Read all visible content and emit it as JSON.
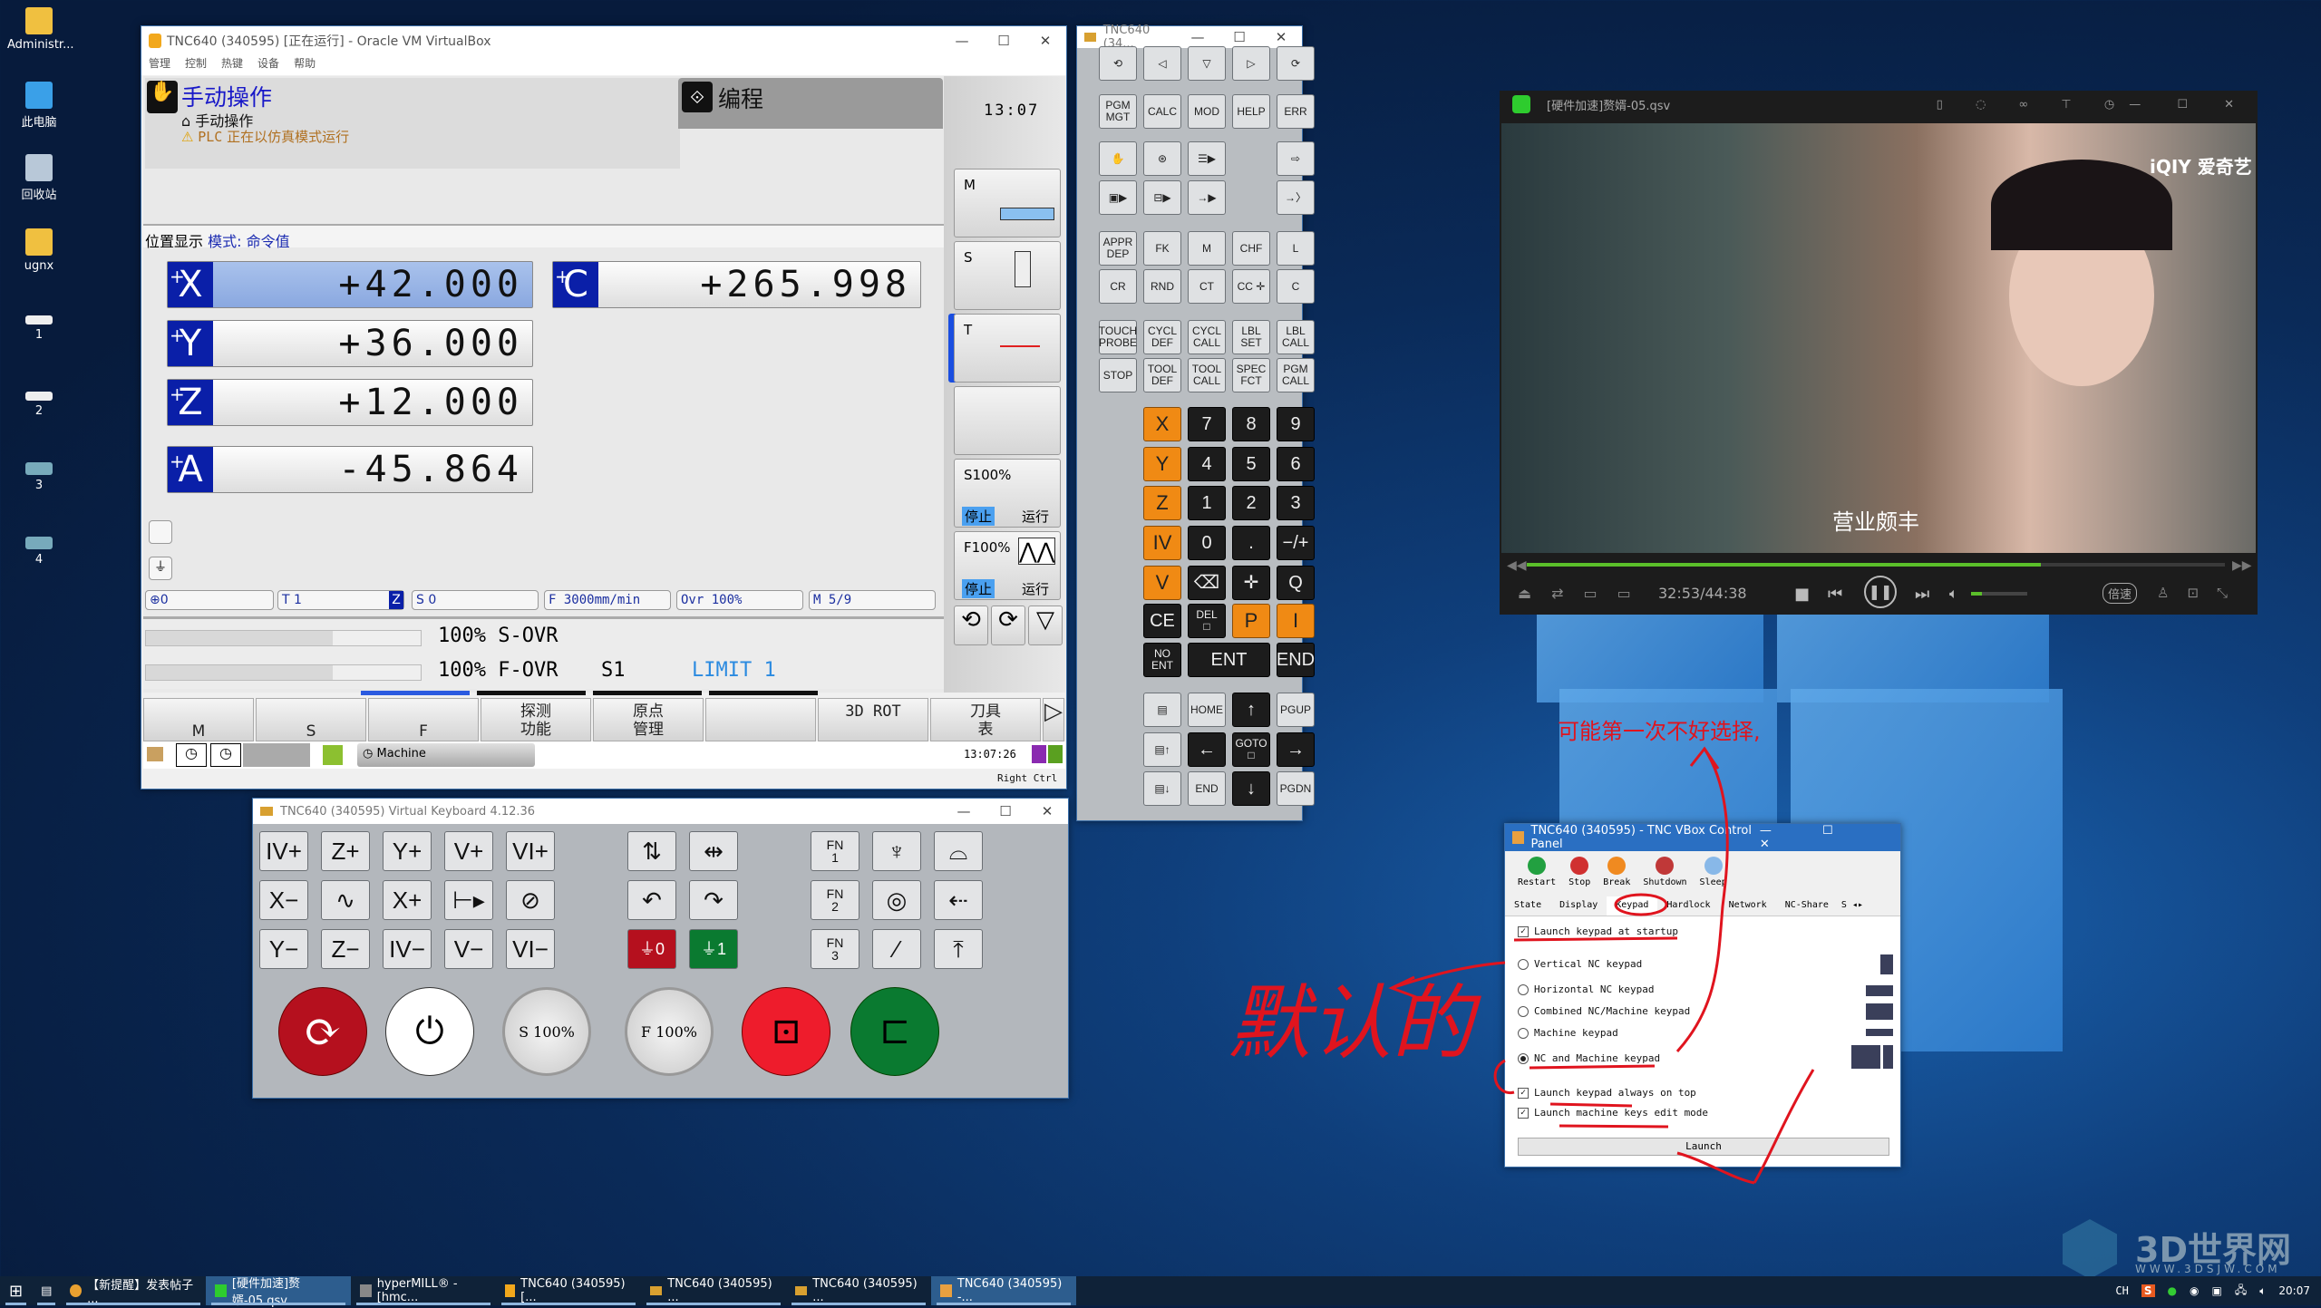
{
  "desktop": {
    "icons": [
      "Administr...",
      "此电脑",
      "回收站",
      "ugnx",
      "1",
      "2",
      "3",
      "4"
    ],
    "watermark": {
      "title": "3D世界网",
      "url": "WWW.3DSJW.COM"
    }
  },
  "tnc": {
    "window_title": "TNC640 (340595) [正在运行] - Oracle VM VirtualBox",
    "menu": [
      "管理",
      "控制",
      "热键",
      "设备",
      "帮助"
    ],
    "mode_title": "手动操作",
    "mode_sub": "手动操作",
    "plc_label": "PLC",
    "plc_msg": "正在以仿真模式运行",
    "prog_tab": "编程",
    "clock": "13:07",
    "pos_label": "位置显示",
    "pos_mode": "模式: 命令值",
    "axes": [
      {
        "name": "X",
        "value": "+42.000"
      },
      {
        "name": "Y",
        "value": "+36.000"
      },
      {
        "name": "Z",
        "value": "+12.000"
      },
      {
        "name": "A",
        "value": "-45.864"
      },
      {
        "name": "C",
        "value": "+265.998"
      }
    ],
    "status": {
      "preset": "0",
      "tool": "T 1",
      "tool_axis": "Z",
      "spindle": "S 0",
      "feed": "F 3000mm/min",
      "ovr": "Ovr 100%",
      "m": "M 5/9"
    },
    "s_ovr": "100% S-OVR",
    "f_ovr": "100% F-OVR",
    "s1": "S1",
    "limit": "LIMIT 1",
    "side": {
      "m": "M",
      "s": "S",
      "t": "T",
      "s_pct": "S100%",
      "f_pct": "F100%",
      "stop": "停止",
      "run": "运行"
    },
    "softkeys": [
      "M",
      "S",
      "F",
      "探测\n功能",
      "原点\n管理",
      "",
      "3D ROT",
      "刀具\n表"
    ],
    "taskbar_app": "Machine",
    "taskbar_time": "13:07:26",
    "host_key": "Right Ctrl"
  },
  "keypad": {
    "title": "TNC640 (34...",
    "keys": [
      [
        "⟲",
        "◁",
        "▽",
        "▷",
        "⟳"
      ],
      [
        "PGM\nMGT",
        "CALC",
        "MOD",
        "HELP",
        "ERR"
      ],
      [
        "✋",
        "⊛",
        "☰▶",
        "",
        "⇨"
      ],
      [
        "▣▶",
        "⊟▶",
        "→▶",
        "",
        "→〉"
      ],
      [
        "APPR\nDEP",
        "FK",
        "M",
        "CHF",
        "L"
      ],
      [
        "CR",
        "RND",
        "CT",
        "CC ✛",
        "C"
      ],
      [
        "TOUCH\nPROBE",
        "CYCL\nDEF",
        "CYCL\nCALL",
        "LBL\nSET",
        "LBL\nCALL"
      ],
      [
        "STOP",
        "TOOL\nDEF",
        "TOOL\nCALL",
        "SPEC\nFCT",
        "PGM\nCALL"
      ],
      [
        "",
        "X",
        "7",
        "8",
        "9"
      ],
      [
        "",
        "Y",
        "4",
        "5",
        "6"
      ],
      [
        "",
        "Z",
        "1",
        "2",
        "3"
      ],
      [
        "",
        "IV",
        "0",
        ".",
        "−/+"
      ],
      [
        "",
        "V",
        "⌫",
        "✛",
        "Q"
      ],
      [
        "",
        "CE",
        "DEL\n□",
        "P",
        "I"
      ],
      [
        "",
        "NO\nENT",
        "ENT",
        "",
        "END"
      ],
      [
        "",
        "▤",
        "HOME",
        "↑",
        "PGUP"
      ],
      [
        "",
        "▤↑",
        "←",
        "GOTO\n□",
        "→"
      ],
      [
        "",
        "▤↓",
        "END",
        "↓",
        "PGDN"
      ]
    ]
  },
  "vkb": {
    "title": "TNC640 (340595) Virtual Keyboard 4.12.36",
    "axes": [
      [
        "IV+",
        "Z+",
        "Y+",
        "V+",
        "VI+"
      ],
      [
        "X−",
        "∿",
        "X+",
        "⊢▸",
        "⊘"
      ],
      [
        "Y−",
        "Z−",
        "IV−",
        "V−",
        "VI−"
      ]
    ],
    "mid": [
      [
        "⇅",
        "⇹"
      ],
      [
        "↶",
        "↷"
      ],
      [
        "⏚0",
        "⏚1"
      ]
    ],
    "fn": [
      [
        "FN\n1",
        "♆",
        "⌓"
      ],
      [
        "FN\n2",
        "◎",
        "⇠"
      ],
      [
        "FN\n3",
        "⁄",
        "⤒"
      ]
    ],
    "s_knob": "S 100%",
    "f_knob": "F 100%"
  },
  "player": {
    "title": "[硬件加速]赘婿-05.qsv",
    "logo": "爱奇艺",
    "subtitle": "营业颇丰",
    "time": "32:53/44:38",
    "progress": 0.737,
    "volume": 0.2,
    "speed": "倍速"
  },
  "panel": {
    "title": "TNC640 (340595) - TNC VBox Control Panel",
    "toolbar": [
      "Restart",
      "Stop",
      "Break",
      "Shutdown",
      "Sleep"
    ],
    "tabs": [
      "State",
      "Display",
      "Keypad",
      "Hardlock",
      "Network",
      "NC-Share",
      "S"
    ],
    "launch_startup": "Launch keypad at startup",
    "options": [
      "Vertical NC keypad",
      "Horizontal NC keypad",
      "Combined NC/Machine keypad",
      "Machine keypad",
      "NC and Machine keypad"
    ],
    "selected": 4,
    "always_top": "Launch keypad always on top",
    "edit_mode": "Launch machine keys edit mode",
    "launch": "Launch"
  },
  "annotations": {
    "note1": "可能第一次不好选择,",
    "note2": "默认的"
  },
  "taskbar": {
    "items": [
      "【新提醒】发表帖子 ...",
      "[硬件加速]赘婿-05.qsv",
      "hyperMILL® - [hmc...",
      "TNC640 (340595) [...",
      "TNC640 (340595) ...",
      "TNC640 (340595) ...",
      "TNC640 (340595) -..."
    ],
    "lang": "CH",
    "clock": "20:07"
  }
}
